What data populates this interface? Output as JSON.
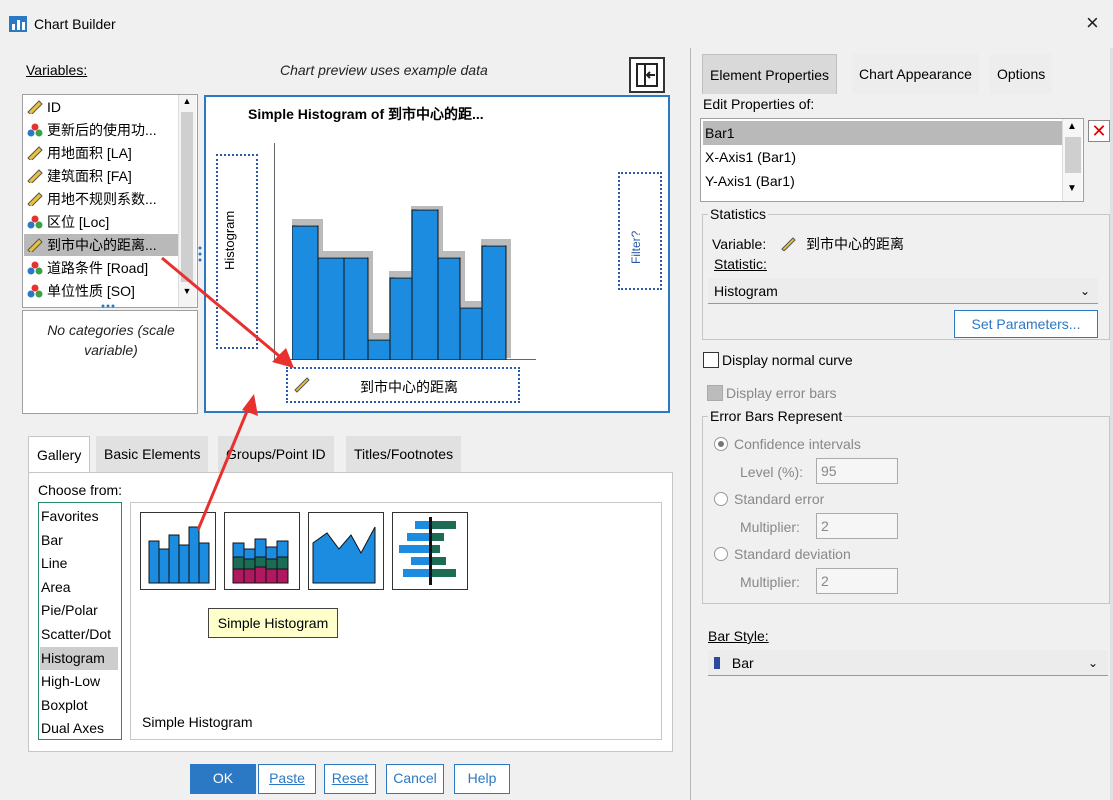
{
  "window": {
    "title": "Chart Builder",
    "close": "×"
  },
  "left": {
    "variables_label": "Variables:",
    "preview_note": "Chart preview uses example data",
    "variables": [
      {
        "name": "ID",
        "icon": "scale-ruler-icon",
        "selected": false
      },
      {
        "name": "更新后的使用功...",
        "icon": "nominal-shapes-icon",
        "selected": false
      },
      {
        "name": "用地面积 [LA]",
        "icon": "scale-ruler-icon",
        "selected": false
      },
      {
        "name": "建筑面积 [FA]",
        "icon": "scale-ruler-icon",
        "selected": false
      },
      {
        "name": "用地不规则系数...",
        "icon": "scale-ruler-icon",
        "selected": false
      },
      {
        "name": "区位 [Loc]",
        "icon": "nominal-shapes-icon",
        "selected": false
      },
      {
        "name": "到市中心的距离...",
        "icon": "scale-ruler-icon",
        "selected": true
      },
      {
        "name": "道路条件 [Road]",
        "icon": "nominal-shapes-icon",
        "selected": false
      },
      {
        "name": "单位性质 [SO]",
        "icon": "nominal-shapes-icon",
        "selected": false
      }
    ],
    "categories_note": "No categories (scale variable)",
    "canvas": {
      "title": "Simple Histogram of 到市中心的距...",
      "y_drop": "Histogram",
      "filter": "Filter?",
      "x_drop": "到市中心的距离"
    },
    "tabs": [
      "Gallery",
      "Basic Elements",
      "Groups/Point ID",
      "Titles/Footnotes"
    ],
    "active_tab": "Gallery",
    "choose_from": "Choose from:",
    "chart_types": [
      "Favorites",
      "Bar",
      "Line",
      "Area",
      "Pie/Polar",
      "Scatter/Dot",
      "Histogram",
      "High-Low",
      "Boxplot",
      "Dual Axes"
    ],
    "selected_type": "Histogram",
    "thumbnails": [
      "simple-histogram-icon",
      "stacked-histogram-icon",
      "frequency-polygon-icon",
      "population-pyramid-icon"
    ],
    "tooltip": "Simple Histogram",
    "gallery_caption": "Simple Histogram"
  },
  "buttons": {
    "ok": "OK",
    "paste": "Paste",
    "reset": "Reset",
    "cancel": "Cancel",
    "help": "Help"
  },
  "right": {
    "tabs": [
      "Element Properties",
      "Chart Appearance",
      "Options"
    ],
    "active_tab": "Element Properties",
    "edit_props_label": "Edit Properties of:",
    "props_items": [
      "Bar1",
      "X-Axis1 (Bar1)",
      "Y-Axis1 (Bar1)"
    ],
    "selected_prop": "Bar1",
    "statistics_legend": "Statistics",
    "variable_label": "Variable:",
    "variable_value": "到市中心的距离",
    "statistic_label": "Statistic:",
    "statistic_value": "Histogram",
    "set_parameters": "Set Parameters...",
    "display_normal_curve": "Display normal curve",
    "display_error_bars": "Display error bars",
    "error_bars_legend": "Error Bars Represent",
    "confidence_intervals": "Confidence intervals",
    "level_label": "Level (%):",
    "level_value": "95",
    "standard_error": "Standard error",
    "multiplier_label": "Multiplier:",
    "se_multiplier": "2",
    "standard_deviation": "Standard deviation",
    "sd_multiplier": "2",
    "bar_style_label": "Bar Style:",
    "bar_style_value": "Bar"
  },
  "colors": {
    "accent": "#2b78c4",
    "bar_fill": "#1c8ce0",
    "annotation_red": "#e8312f"
  }
}
